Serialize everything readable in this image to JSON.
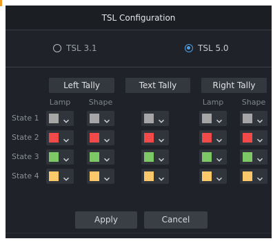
{
  "dialog": {
    "title": "TSL Configuration"
  },
  "protocol": {
    "options": [
      {
        "label": "TSL 3.1",
        "selected": false
      },
      {
        "label": "TSL 5.0",
        "selected": true
      }
    ]
  },
  "sections": {
    "left": "Left Tally",
    "text": "Text Tally",
    "right": "Right Tally"
  },
  "columns": {
    "lamp": "Lamp",
    "shape": "Shape"
  },
  "states": [
    {
      "label": "State 1",
      "color": "#a6a6a6"
    },
    {
      "label": "State 2",
      "color": "#f04a4a"
    },
    {
      "label": "State 3",
      "color": "#7dc767"
    },
    {
      "label": "State 4",
      "color": "#fbc86a"
    }
  ],
  "buttons": {
    "apply": "Apply",
    "cancel": "Cancel"
  },
  "icons": {
    "dropdown": "chevron-down-icon",
    "radio": "radio-icon"
  }
}
